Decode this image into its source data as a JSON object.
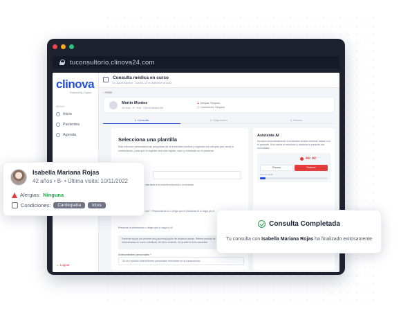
{
  "browser": {
    "url": "tuconsultorio.clinova24.com",
    "dot_colors": [
      "#e5484d",
      "#f5a623",
      "#2ec27e"
    ]
  },
  "sidebar": {
    "logo": "clinova",
    "logo_sub": "Powered by Cognex",
    "section": "MENÚ",
    "items": [
      {
        "label": "Inicio"
      },
      {
        "label": "Pacientes"
      },
      {
        "label": "Agenda"
      }
    ],
    "logout": "Logout"
  },
  "topbar": {
    "title": "Consulta médica en curso",
    "subtitle": "Dr. David Ramírez · Jueves, 11 de diciembre de 2025"
  },
  "back_label": "Atrás",
  "patient_card": {
    "name": "Martín Montes",
    "info": "45 años · M · H15 · Clínica Médica 8/6",
    "allergies_label": "Alergias:",
    "allergies_value": "Ninguna",
    "conditions_label": "Condiciones:",
    "conditions_value": "Ninguna"
  },
  "steps": [
    "1. Consulta",
    "2. Diagnóstico",
    "3. Receta"
  ],
  "main_card": {
    "title": "Selecciona una plantilla",
    "description": "Esta elección personaliza las preguntas de la entrevista médica y organiza los campos que verás a continuación, para que el registro sea más rápido, claro y enfocado en el paciente.",
    "hint": "Puedes cambiar la plantilla más tarde si la consulta evoluciona o lo necesitas",
    "line1": "Pulsa \"Capturar primera vez\". Responderás tú o dirige que el Asistente AI lo haga por ti.",
    "line2": "Presenta la información o dirige que lo haga la IA",
    "quote": "Paciente acude por primera vez para evaluación de alopecia areata. Refiere pérdida de cabello en placas redondeadas en cuero cabelludo, de inicio reciente, sin prurito ni dolor asociado.",
    "antecedentes_label": "Antecedentes personales *",
    "antecedentes_value": "No se reportan antecedentes personales relevantes en la transcripción."
  },
  "assistant": {
    "title": "Asistente AI",
    "description": "Escucha automáticamente la entrevista médica mientras hablas con el paciente. Solo activa el micrófono y continúa tu consulta con normalidad.",
    "timer": "00:02",
    "pause_label": "Pausar",
    "stop_label": "Detener",
    "level_label": "Nivel de audio",
    "level": 0.08
  },
  "float_patient": {
    "name": "Isabella Mariana Rojas",
    "info": "42 años • B- • Última visita: 10/11/2022",
    "allergies_label": "Alergias:",
    "allergies_value": "Ninguna",
    "conditions_label": "Condiciones:",
    "conditions": [
      "Cardiopatía",
      "Ictus"
    ]
  },
  "toast": {
    "title": "Consulta Completada",
    "msg_prefix": "Tu consulta con",
    "msg_name": "Isabella Mariana Rojas",
    "msg_suffix": "ha finalizado exitosamente"
  },
  "colors": {
    "accent": "#1f4fd6",
    "danger": "#e23b3b",
    "success": "#1fa34a"
  }
}
